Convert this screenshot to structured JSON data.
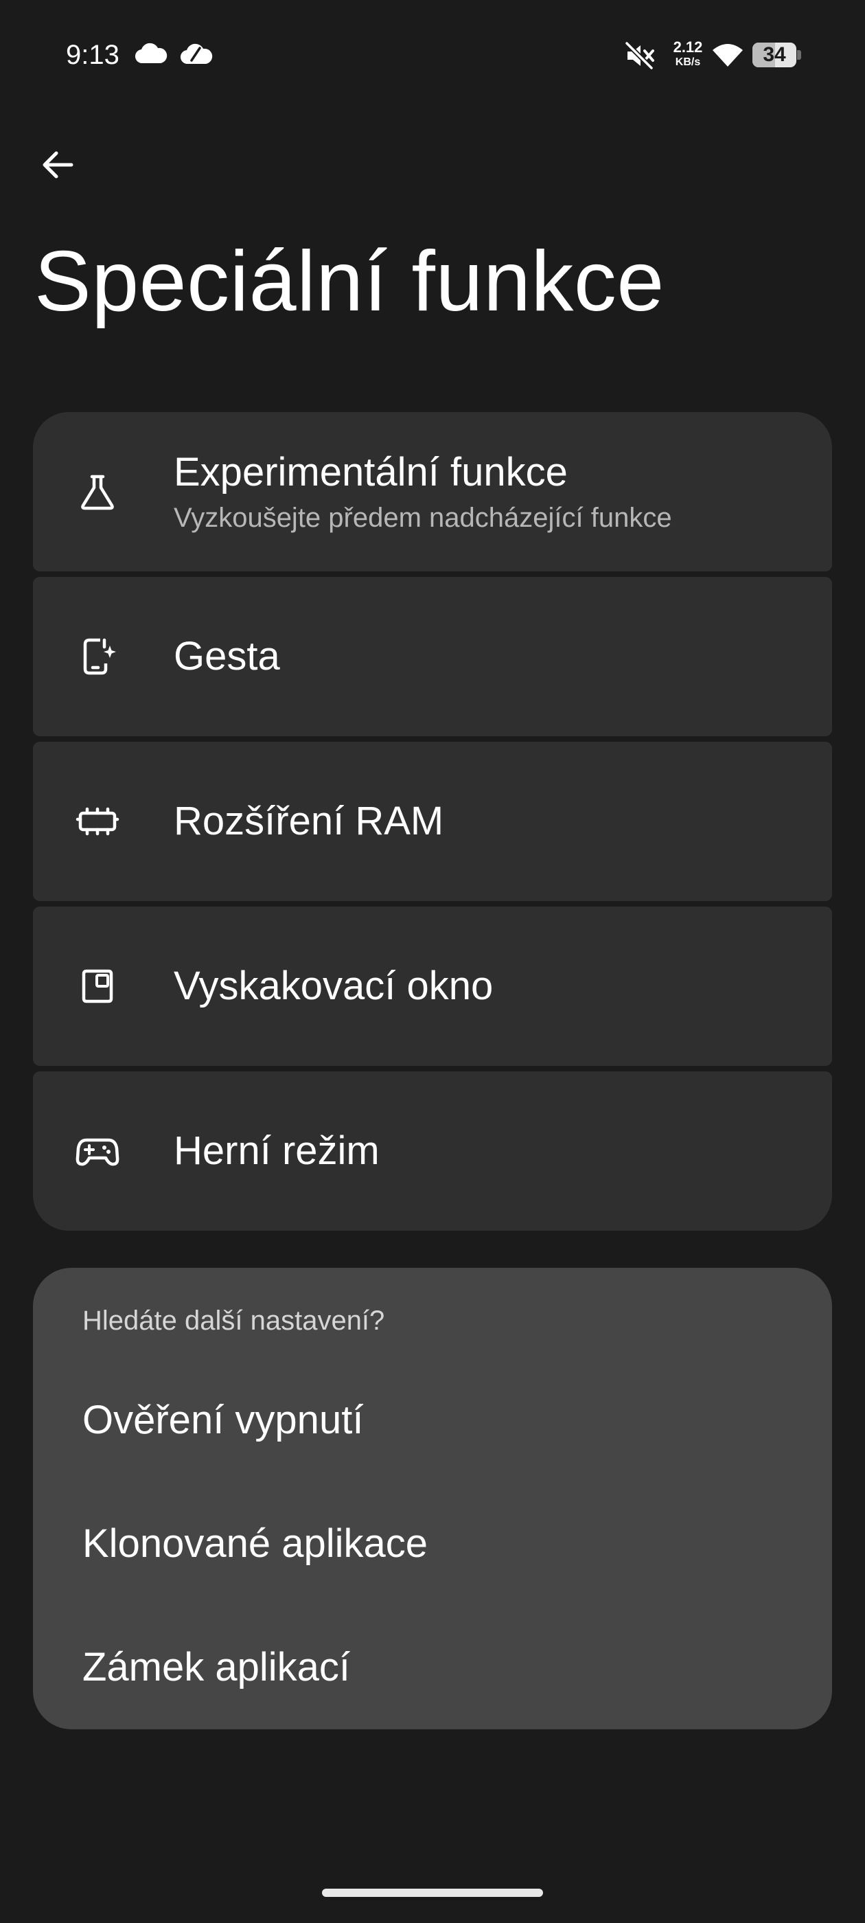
{
  "status_bar": {
    "time": "9:13",
    "net_speed_value": "2.12",
    "net_speed_unit": "KB/s",
    "battery_level": "34",
    "icons": [
      "cloud-icon",
      "cloud-sync-icon",
      "muted-speaker-icon",
      "wifi-icon",
      "battery-icon"
    ]
  },
  "header": {
    "back_icon": "arrow-left-icon",
    "title": "Speciální funkce"
  },
  "features": {
    "items": [
      {
        "icon": "flask-icon",
        "title": "Experimentální funkce",
        "subtitle": "Vyzkoušejte předem nadcházející funkce"
      },
      {
        "icon": "gesture-phone-icon",
        "title": "Gesta"
      },
      {
        "icon": "ram-chip-icon",
        "title": "Rozšíření RAM"
      },
      {
        "icon": "popup-window-icon",
        "title": "Vyskakovací okno"
      },
      {
        "icon": "gamepad-icon",
        "title": "Herní režim"
      }
    ]
  },
  "suggestions": {
    "heading": "Hledáte další nastavení?",
    "links": [
      "Ověření vypnutí",
      "Klonované aplikace",
      "Zámek aplikací"
    ]
  },
  "colors": {
    "background": "#1b1b1b",
    "card": "#2f2f2f",
    "suggest_card": "#464646",
    "text_primary": "#ffffff",
    "text_secondary": "#b7b7b7"
  }
}
